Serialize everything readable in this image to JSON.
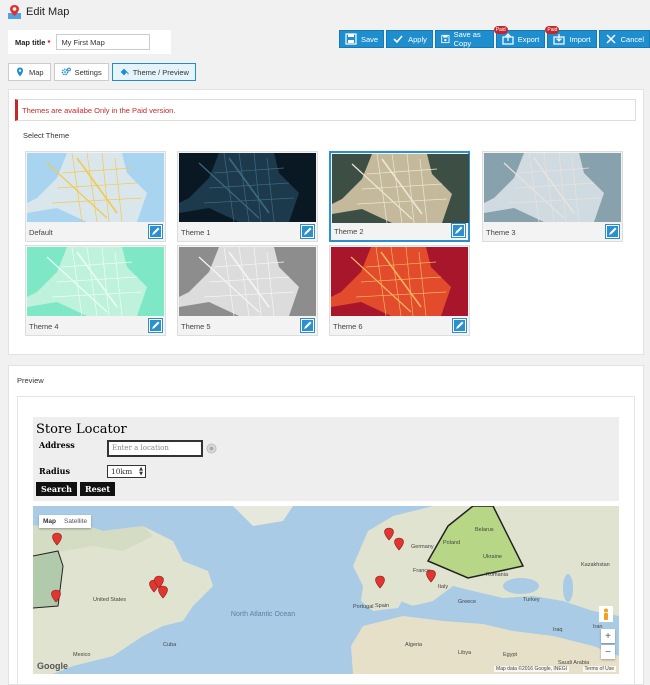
{
  "header": {
    "title": "Edit Map"
  },
  "map_title": {
    "label": "Map title",
    "required_mark": "*",
    "value": "My First Map"
  },
  "toolbar": {
    "save": "Save",
    "apply": "Apply",
    "save_copy": "Save as Copy",
    "export": "Export",
    "import": "Import",
    "cancel": "Cancel",
    "paid_badge": "Paid"
  },
  "tabs": {
    "map": "Map",
    "settings": "Settings",
    "theme": "Theme / Preview"
  },
  "notice": "Themes are availabe Only in the Paid version.",
  "select_theme_label": "Select Theme",
  "themes": [
    {
      "name": "Default",
      "bg": "#d9e7ec",
      "water": "#a8d4f0",
      "road": "#f4c84a",
      "text": "#444"
    },
    {
      "name": "Theme 1",
      "bg": "#1c3a4b",
      "water": "#0a1824",
      "road": "#3c6a82",
      "text": "#ddd"
    },
    {
      "name": "Theme 2",
      "bg": "#c5b99c",
      "water": "#3d4f45",
      "road": "#ece7d5",
      "text": "#222"
    },
    {
      "name": "Theme 3",
      "bg": "#cfdbe0",
      "water": "#88a2ad",
      "road": "#e9e2dd",
      "text": "#444"
    },
    {
      "name": "Theme 4",
      "bg": "#bff2dc",
      "water": "#7ee7c5",
      "road": "#eafff6",
      "text": "#333"
    },
    {
      "name": "Theme 5",
      "bg": "#dcdcdc",
      "water": "#8d8d8d",
      "road": "#f5f5f5",
      "text": "#333"
    },
    {
      "name": "Theme 6",
      "bg": "#e24b2c",
      "water": "#a7162a",
      "road": "#f4b45e",
      "text": "#222"
    }
  ],
  "preview_label": "Preview",
  "store": {
    "title": "Store Locator",
    "address_label": "Address",
    "address_placeholder": "Enter a location",
    "radius_label": "Radius",
    "radius_value": "10km",
    "search_btn": "Search",
    "reset_btn": "Reset"
  },
  "map_preview": {
    "type_map": "Map",
    "type_satellite": "Satellite",
    "ocean_label": "North Atlantic Ocean",
    "places": [
      "France",
      "Poland",
      "Belarus",
      "Ukraine",
      "Germany",
      "Spain",
      "Portugal",
      "Romania",
      "Italy",
      "Greece",
      "Kazakhstan",
      "Iran",
      "Iraq",
      "Turkey",
      "Egypt",
      "Libya",
      "Algeria",
      "Saudi Arabia",
      "United States",
      "Mexico",
      "Cuba"
    ],
    "attribution": "Map data ©2016 Google, INEGI",
    "terms": "Terms of Use",
    "google": "Google",
    "zoom_in": "+",
    "zoom_out": "−"
  },
  "colors": {
    "accent": "#1e8ecf",
    "paid": "#c0282d",
    "notice": "#c62828"
  }
}
